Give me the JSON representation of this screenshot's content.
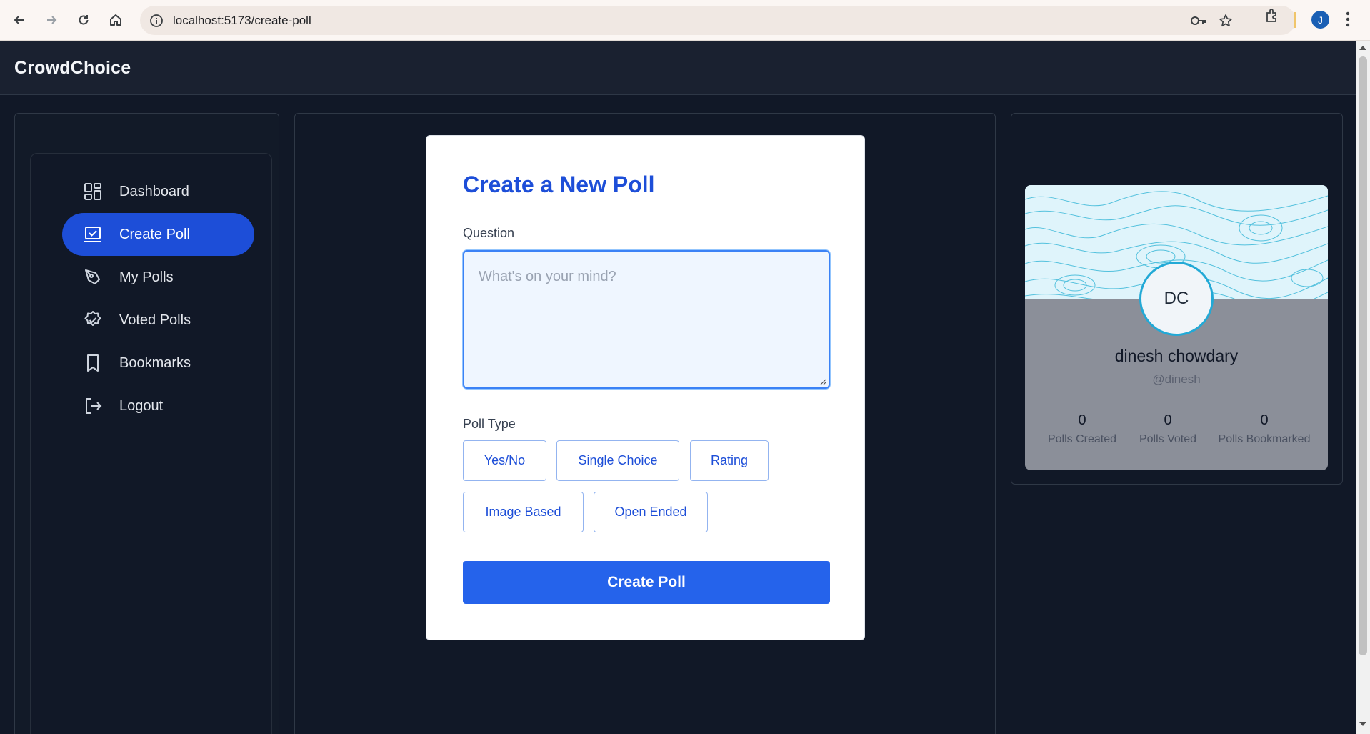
{
  "browser": {
    "url": "localhost:5173/create-poll",
    "profile_initial": "J"
  },
  "app": {
    "brand": "CrowdChoice"
  },
  "sidebar": {
    "items": [
      {
        "label": "Dashboard",
        "icon": "dashboard-icon"
      },
      {
        "label": "Create Poll",
        "icon": "create-poll-icon",
        "active": true
      },
      {
        "label": "My Polls",
        "icon": "pen-icon"
      },
      {
        "label": "Voted Polls",
        "icon": "badge-check-icon"
      },
      {
        "label": "Bookmarks",
        "icon": "bookmark-icon"
      },
      {
        "label": "Logout",
        "icon": "logout-icon"
      }
    ]
  },
  "form": {
    "title": "Create a New Poll",
    "question_label": "Question",
    "question_placeholder": "What's on your mind?",
    "poll_type_label": "Poll Type",
    "poll_types": [
      "Yes/No",
      "Single Choice",
      "Rating",
      "Image Based",
      "Open Ended"
    ],
    "submit_label": "Create Poll"
  },
  "profile": {
    "initials": "DC",
    "name": "dinesh chowdary",
    "handle": "@dinesh",
    "stats": [
      {
        "value": "0",
        "label": "Polls Created"
      },
      {
        "value": "0",
        "label": "Polls Voted"
      },
      {
        "value": "0",
        "label": "Polls Bookmarked"
      }
    ]
  },
  "colors": {
    "accent": "#1d4ed8",
    "button": "#2563eb",
    "background": "#111827"
  }
}
